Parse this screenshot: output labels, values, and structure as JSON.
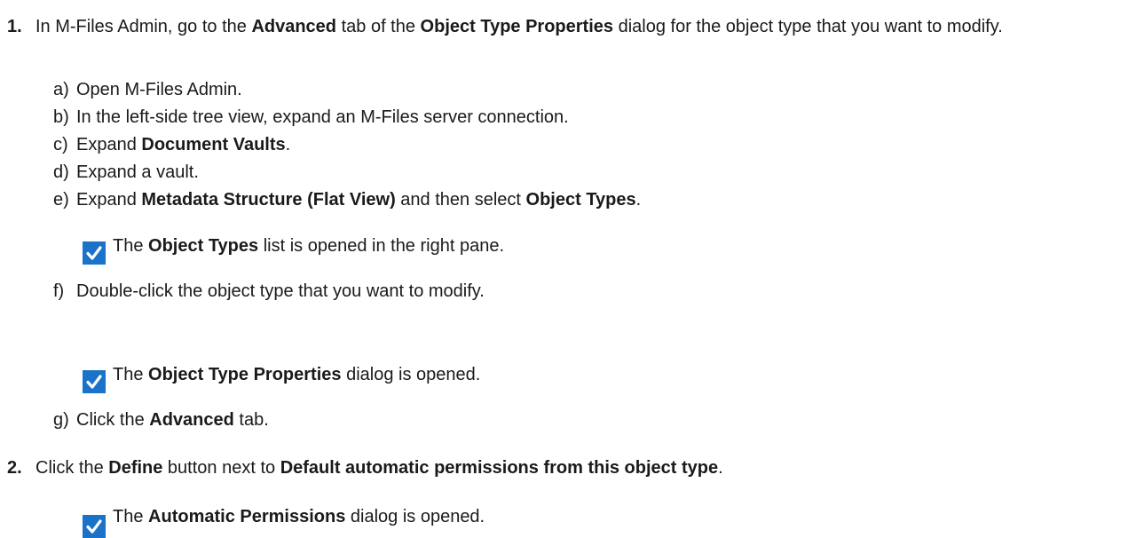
{
  "step1": {
    "number": "1.",
    "text_parts": [
      "In M-Files Admin, go to the ",
      "Advanced",
      " tab of the ",
      "Object Type Properties",
      " dialog for the object type that you want to modify."
    ],
    "substeps": [
      {
        "letter": "a)",
        "parts": [
          "Open M-Files Admin."
        ]
      },
      {
        "letter": "b)",
        "parts": [
          "In the left-side tree view, expand an M-Files server connection."
        ]
      },
      {
        "letter": "c)",
        "parts": [
          "Expand ",
          "Document Vaults",
          "."
        ]
      },
      {
        "letter": "d)",
        "parts": [
          "Expand a vault."
        ]
      },
      {
        "letter": "e)",
        "parts": [
          "Expand ",
          "Metadata Structure (Flat View)",
          " and then select ",
          "Object Types",
          "."
        ]
      },
      {
        "letter": "f)",
        "parts": [
          "Double-click the object type that you want to modify."
        ]
      },
      {
        "letter": "g)",
        "parts": [
          "Click the ",
          "Advanced",
          " tab."
        ]
      }
    ],
    "results": [
      {
        "parts": [
          "The ",
          "Object Types",
          " list is opened in the right pane."
        ]
      },
      {
        "parts": [
          "The ",
          "Object Type Properties",
          " dialog is opened."
        ]
      }
    ]
  },
  "step2": {
    "number": "2.",
    "parts": [
      "Click the ",
      "Define",
      " button next to ",
      "Default automatic permissions from this object type",
      "."
    ],
    "result": {
      "parts": [
        "The ",
        "Automatic Permissions",
        " dialog is opened."
      ]
    }
  },
  "colors": {
    "check_icon": "#1a73c8"
  }
}
